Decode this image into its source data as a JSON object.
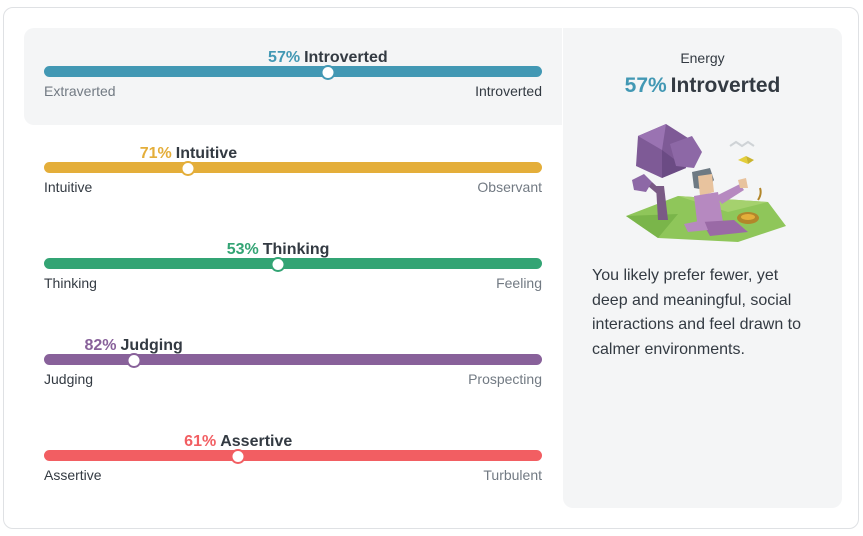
{
  "traits": [
    {
      "pct": "57%",
      "name": "Introverted",
      "left": "Extraverted",
      "right": "Introverted",
      "color": "#4298b4",
      "value": 0.57,
      "active_side": "right"
    },
    {
      "pct": "71%",
      "name": "Intuitive",
      "left": "Intuitive",
      "right": "Observant",
      "color": "#e4ae3a",
      "value": 0.29,
      "active_side": "left"
    },
    {
      "pct": "53%",
      "name": "Thinking",
      "left": "Thinking",
      "right": "Feeling",
      "color": "#33a474",
      "value": 0.47,
      "active_side": "left"
    },
    {
      "pct": "82%",
      "name": "Judging",
      "left": "Judging",
      "right": "Prospecting",
      "color": "#88619a",
      "value": 0.18,
      "active_side": "left"
    },
    {
      "pct": "61%",
      "name": "Assertive",
      "left": "Assertive",
      "right": "Turbulent",
      "color": "#f25e62",
      "value": 0.39,
      "active_side": "left"
    }
  ],
  "panel": {
    "label": "Energy",
    "pct": "57%",
    "name": "Introverted",
    "description": "You likely prefer fewer, yet deep and meaningful, social interactions and feel drawn to calmer environments."
  },
  "illustration": {
    "icon": "introvert-person-under-tree-illustration"
  }
}
